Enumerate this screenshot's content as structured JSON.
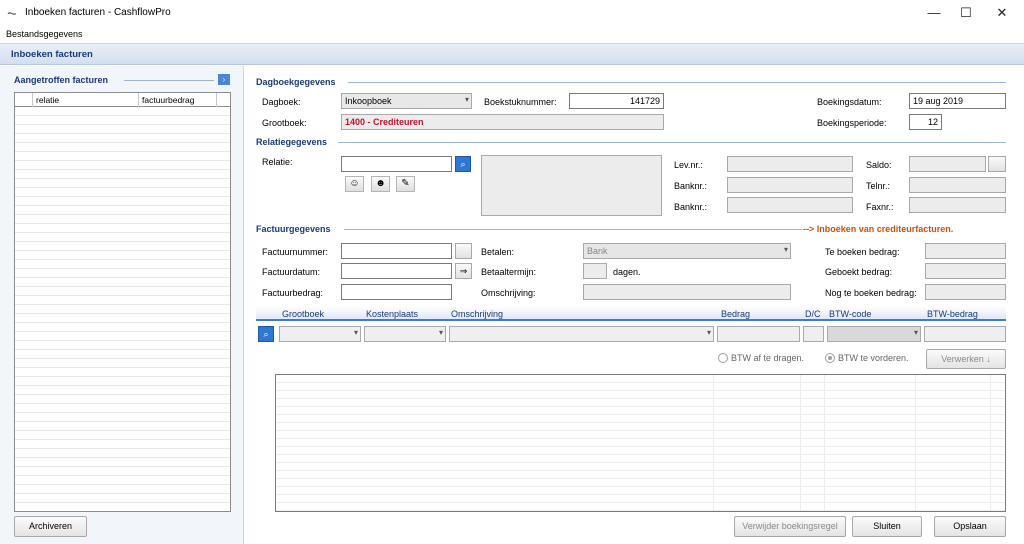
{
  "window": {
    "title": "Inboeken facturen - CashflowPro",
    "minimize_label": "—",
    "maximize_label": "☐",
    "close_label": "✕"
  },
  "menu": {
    "items": [
      "Bestandsgegevens"
    ]
  },
  "form": {
    "header": "Inboeken facturen"
  },
  "left_panel": {
    "title": "Aangetroffen facturen",
    "collapse_label": "›",
    "columns": [
      "relatie",
      "factuurbedrag"
    ],
    "archive_button": "Archiveren"
  },
  "dagboek": {
    "title": "Dagboekgegevens",
    "dagboek_label": "Dagboek:",
    "dagboek_value": "Inkoopboek",
    "boekstuk_label": "Boekstuknummer:",
    "boekstuk_value": "141729",
    "grootboek_label": "Grootboek:",
    "grootboek_value": "1400 - Crediteuren",
    "datum_label": "Boekingsdatum:",
    "datum_value": "19 aug 2019",
    "periode_label": "Boekingsperiode:",
    "periode_value": "12"
  },
  "relatie": {
    "title": "Relatiegegevens",
    "relatie_label": "Relatie:",
    "relatie_value": "",
    "levnr_label": "Lev.nr.:",
    "banknr1_label": "Banknr.:",
    "banknr2_label": "Banknr.:",
    "saldo_label": "Saldo:",
    "telnr_label": "Telnr.:",
    "faxnr_label": "Faxnr.:"
  },
  "factuur": {
    "title": "Factuurgegevens",
    "note": "--> Inboeken van crediteurfacturen.",
    "nummer_label": "Factuurnummer:",
    "datum_label": "Factuurdatum:",
    "bedrag_label": "Factuurbedrag:",
    "betalen_label": "Betalen:",
    "betalen_value": "Bank",
    "termijn_label": "Betaaltermijn:",
    "dagen_label": "dagen.",
    "omschrijving_label": "Omschrijving:",
    "te_boeken_label": "Te boeken bedrag:",
    "geboekt_label": "Geboekt bedrag:",
    "nog_label": "Nog te boeken bedrag:"
  },
  "booking": {
    "columns": [
      "Grootboek",
      "Kostenplaats",
      "Omschrijving",
      "Bedrag",
      "D/C",
      "BTW-code",
      "BTW-bedrag"
    ],
    "radio_afdragen": "BTW af te dragen.",
    "radio_vorderen": "BTW te vorderen.",
    "verwerken_button": "Verwerken ↓"
  },
  "footer": {
    "delete_line_button": "Verwijder boekingsregel",
    "close_button": "Sluiten",
    "save_button": "Opslaan"
  }
}
